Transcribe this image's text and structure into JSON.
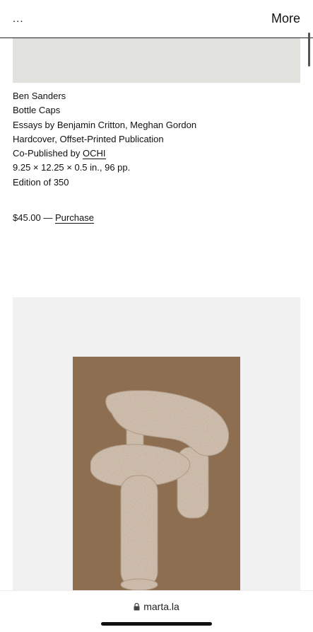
{
  "nav": {
    "menu_label": "...",
    "more_label": "More"
  },
  "details": {
    "author": "Ben Sanders",
    "title": "Bottle Caps",
    "essays": "Essays by Benjamin Critton, Meghan Gordon",
    "format": "Hardcover, Offset-Printed Publication",
    "copublished_prefix": "Co-Published by ",
    "copublisher": "OCHI",
    "dimensions": "9.25 × 12.25 × 0.5 in., 96 pp.",
    "edition": "Edition of 350"
  },
  "purchase": {
    "price": "$45.00",
    "separator": " — ",
    "label": "Purchase"
  },
  "browser": {
    "url": "marta.la"
  },
  "colors": {
    "placeholder": "#e1e2de",
    "panel": "#f1f1f2",
    "cover": "#8d6e50",
    "sculpture": "#d9c7b5"
  }
}
